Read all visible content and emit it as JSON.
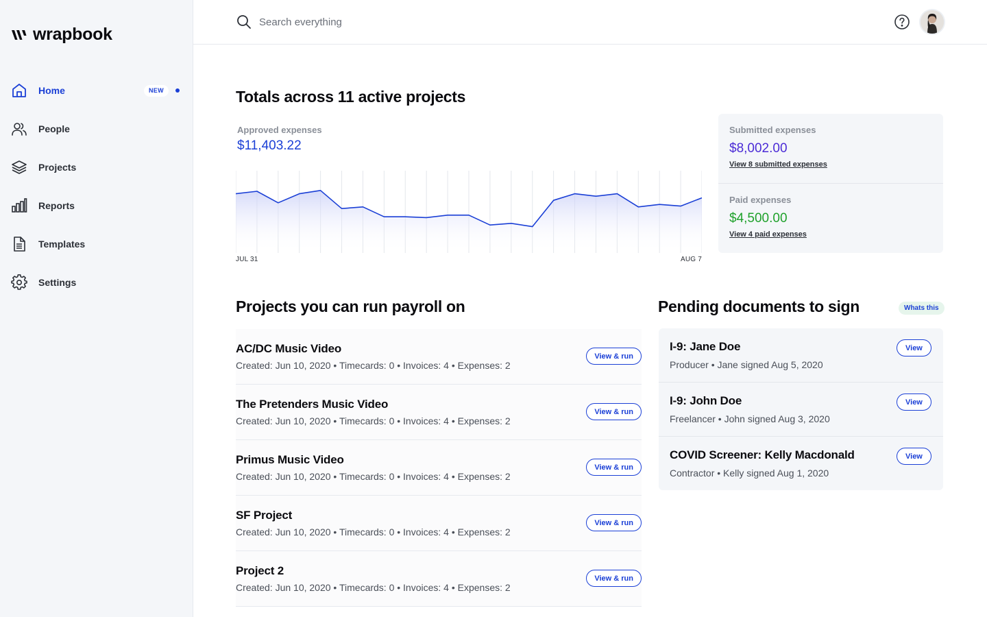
{
  "app": {
    "logo_text": "wrapbook"
  },
  "sidebar": {
    "items": [
      {
        "label": "Home",
        "icon": "home-icon",
        "badge": "NEW",
        "active": true
      },
      {
        "label": "People",
        "icon": "people-icon"
      },
      {
        "label": "Projects",
        "icon": "layers-icon"
      },
      {
        "label": "Reports",
        "icon": "bar-chart-icon"
      },
      {
        "label": "Templates",
        "icon": "document-icon"
      },
      {
        "label": "Settings",
        "icon": "gear-icon"
      }
    ]
  },
  "topbar": {
    "search_placeholder": "Search everything",
    "help_icon": "help-icon"
  },
  "totals": {
    "title": "Totals across 11 active projects",
    "approved_label": "Approved expenses",
    "approved_value": "$11,403.22",
    "chart_start": "JUL 31",
    "chart_end": "AUG 7",
    "submitted_label": "Submitted expenses",
    "submitted_value": "$8,002.00",
    "submitted_link": "View 8 submitted expenses",
    "paid_label": "Paid expenses",
    "paid_value": "$4,500.00",
    "paid_link": "View 4 paid expenses"
  },
  "chart_data": {
    "type": "area",
    "x_start": "JUL 31",
    "x_end": "AUG 7",
    "values": [
      0.72,
      0.75,
      0.61,
      0.72,
      0.76,
      0.54,
      0.56,
      0.44,
      0.44,
      0.43,
      0.46,
      0.46,
      0.34,
      0.36,
      0.32,
      0.64,
      0.72,
      0.69,
      0.72,
      0.56,
      0.59,
      0.57,
      0.67
    ],
    "grid": true
  },
  "projects": {
    "title": "Projects you can run payroll on",
    "button_label": "View & run",
    "items": [
      {
        "name": "AC/DC Music Video",
        "meta": "Created: Jun 10, 2020 • Timecards: 0 • Invoices: 4 • Expenses: 2"
      },
      {
        "name": "The Pretenders Music Video",
        "meta": "Created: Jun 10, 2020 • Timecards: 0 • Invoices: 4 • Expenses: 2"
      },
      {
        "name": "Primus Music Video",
        "meta": "Created: Jun 10, 2020 • Timecards: 0 • Invoices: 4 • Expenses: 2"
      },
      {
        "name": "SF Project",
        "meta": "Created: Jun 10, 2020 • Timecards: 0 • Invoices: 4 • Expenses: 2"
      },
      {
        "name": "Project 2",
        "meta": "Created: Jun 10, 2020 • Timecards: 0 • Invoices: 4 • Expenses: 2"
      }
    ]
  },
  "documents": {
    "title": "Pending documents to sign",
    "whats_this": "Whats this",
    "button_label": "View",
    "items": [
      {
        "title": "I-9: Jane Doe",
        "meta": "Producer • Jane signed Aug 5, 2020"
      },
      {
        "title": "I-9: John Doe",
        "meta": "Freelancer • John signed Aug 3, 2020"
      },
      {
        "title": "COVID Screener: Kelly Macdonald",
        "meta": "Contractor • Kelly signed Aug 1, 2020"
      }
    ]
  },
  "colors": {
    "accent": "#1a3fd6",
    "submitted": "#4b2bd6",
    "paid": "#1fa12b",
    "sidebar_bg": "#f4f6f9"
  }
}
